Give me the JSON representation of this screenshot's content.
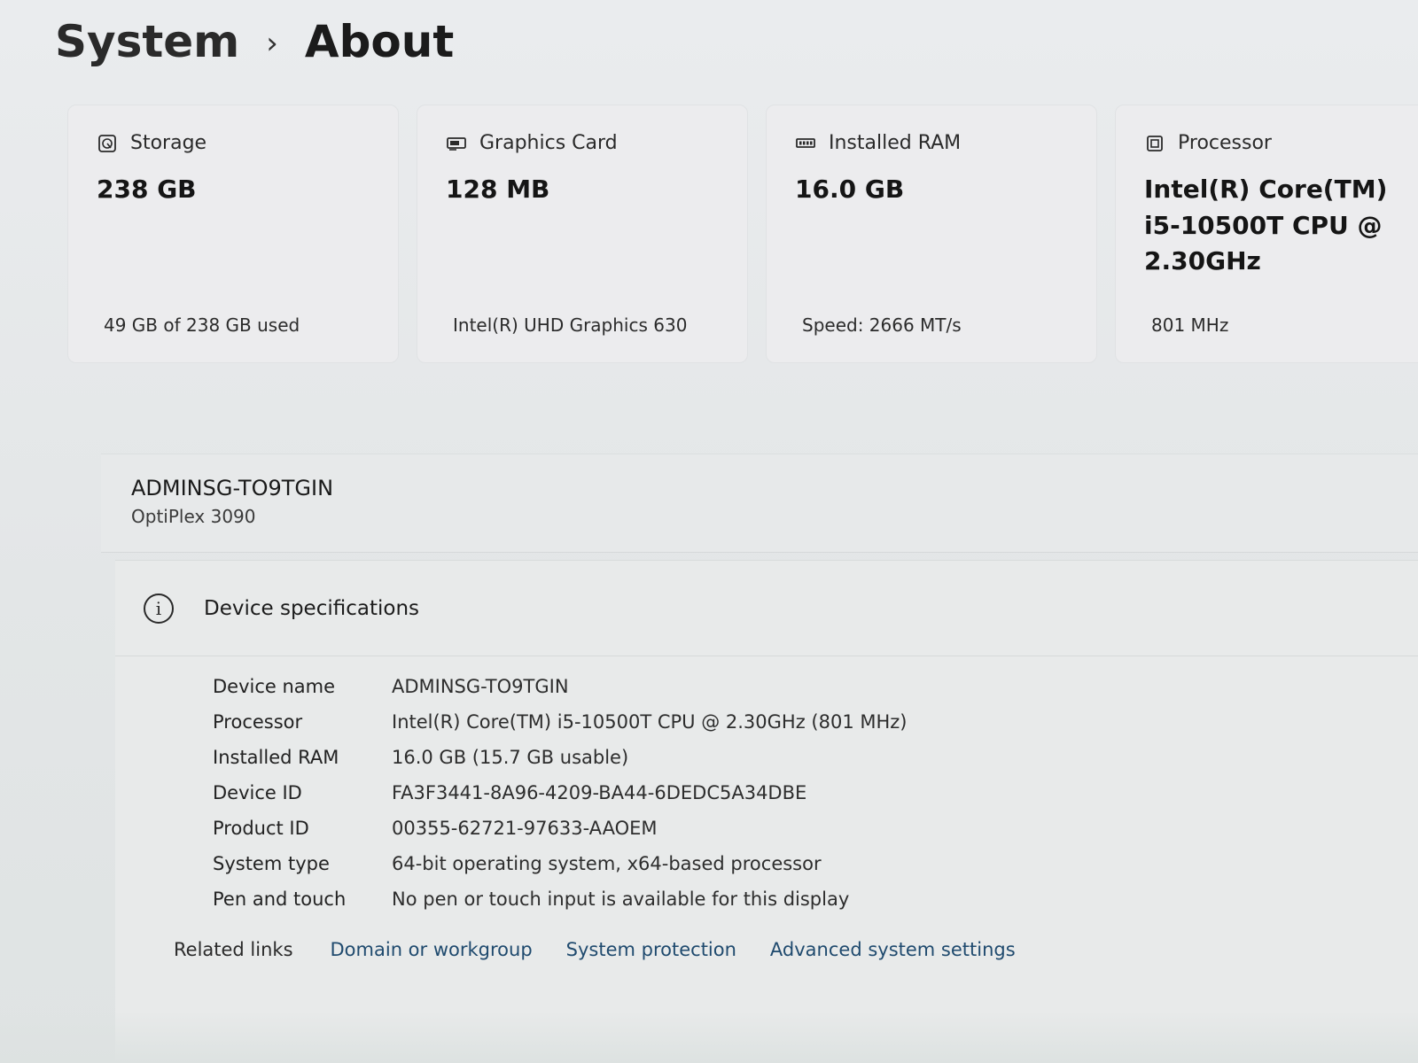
{
  "breadcrumb": {
    "parent": "System",
    "separator": "›",
    "current": "About"
  },
  "cards": {
    "storage": {
      "title": "Storage",
      "value": "238 GB",
      "detail": "49 GB of 238 GB used",
      "icon": "storage-icon"
    },
    "graphics": {
      "title": "Graphics Card",
      "value": "128 MB",
      "detail": "Intel(R) UHD Graphics 630",
      "icon": "graphics-card-icon"
    },
    "ram": {
      "title": "Installed RAM",
      "value": "16.0 GB",
      "detail": "Speed: 2666 MT/s",
      "icon": "ram-icon"
    },
    "processor": {
      "title": "Processor",
      "value": "Intel(R) Core(TM) i5-10500T CPU @ 2.30GHz",
      "detail": "801 MHz",
      "icon": "processor-icon"
    }
  },
  "device": {
    "name": "ADMINSG-TO9TGIN",
    "model": "OptiPlex 3090"
  },
  "specs": {
    "title": "Device specifications",
    "icon": "info-icon",
    "rows": [
      {
        "label": "Device name",
        "value": "ADMINSG-TO9TGIN"
      },
      {
        "label": "Processor",
        "value": "Intel(R) Core(TM) i5-10500T CPU @ 2.30GHz (801 MHz)"
      },
      {
        "label": "Installed RAM",
        "value": "16.0 GB (15.7 GB usable)"
      },
      {
        "label": "Device ID",
        "value": "FA3F3441-8A96-4209-BA44-6DEDC5A34DBE"
      },
      {
        "label": "Product ID",
        "value": "00355-62721-97633-AAOEM"
      },
      {
        "label": "System type",
        "value": "64-bit operating system, x64-based processor"
      },
      {
        "label": "Pen and touch",
        "value": "No pen or touch input is available for this display"
      }
    ]
  },
  "related": {
    "label": "Related links",
    "links": [
      "Domain or workgroup",
      "System protection",
      "Advanced system settings"
    ]
  },
  "colors": {
    "link": "#1f4a6e",
    "background": "#e6e9ea",
    "card": "#ececee"
  }
}
